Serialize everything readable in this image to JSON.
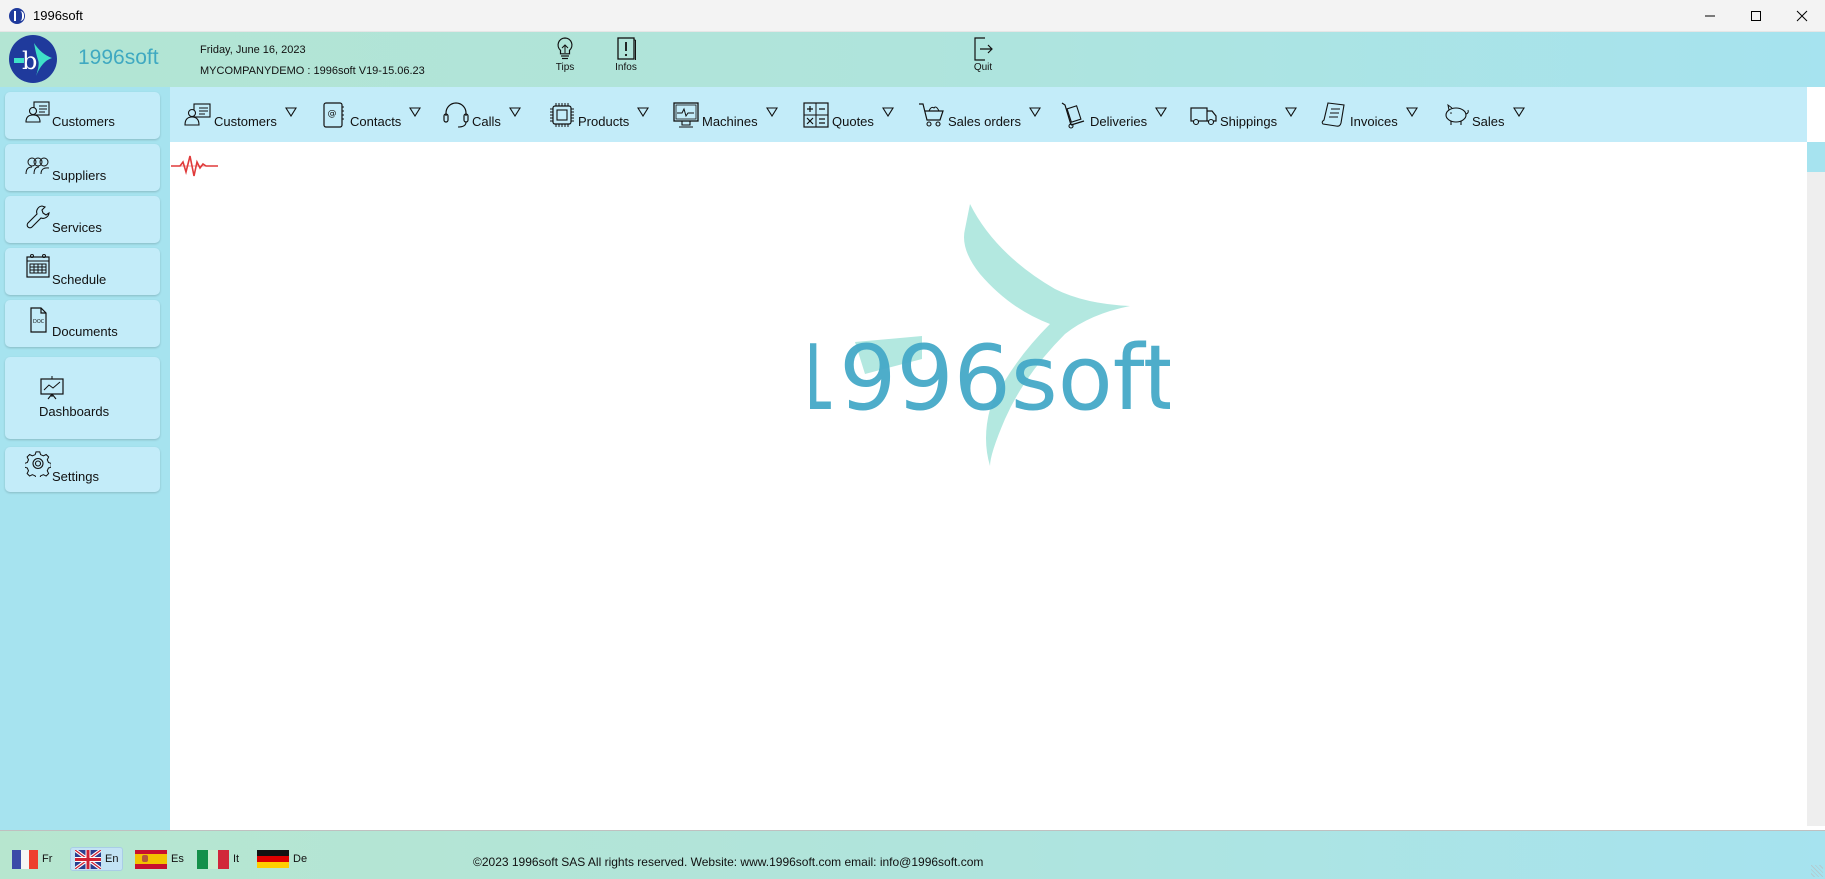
{
  "window": {
    "title": "1996soft",
    "controls": [
      "minimize",
      "maximize",
      "close"
    ]
  },
  "header": {
    "brand": "1996soft",
    "date": "Friday, June 16, 2023",
    "company": "MYCOMPANYDEMO : 1996soft V19-15.06.23",
    "buttons": [
      {
        "label": "Tips",
        "icon": "lightbulb-icon"
      },
      {
        "label": "Infos",
        "icon": "info-book-icon"
      },
      {
        "label": "Quit",
        "icon": "exit-icon"
      }
    ]
  },
  "sidebar": {
    "items": [
      {
        "label": "Customers",
        "icon": "customers-icon"
      },
      {
        "label": "Suppliers",
        "icon": "suppliers-icon"
      },
      {
        "label": "Services",
        "icon": "wrench-icon"
      },
      {
        "label": "Schedule",
        "icon": "calendar-icon"
      },
      {
        "label": "Documents",
        "icon": "document-icon"
      },
      {
        "label": "Dashboards",
        "icon": "dashboard-icon"
      },
      {
        "label": "Settings",
        "icon": "gear-icon"
      }
    ]
  },
  "navbar": {
    "items": [
      {
        "label": "Customers",
        "icon": "customers-icon"
      },
      {
        "label": "Contacts",
        "icon": "contacts-book-icon"
      },
      {
        "label": "Calls",
        "icon": "headset-icon"
      },
      {
        "label": "Products",
        "icon": "chip-icon"
      },
      {
        "label": "Machines",
        "icon": "monitor-icon"
      },
      {
        "label": "Quotes",
        "icon": "calculator-icon"
      },
      {
        "label": "Sales orders",
        "icon": "cart-icon"
      },
      {
        "label": "Deliveries",
        "icon": "hand-truck-icon"
      },
      {
        "label": "Shippings",
        "icon": "truck-icon"
      },
      {
        "label": "Invoices",
        "icon": "invoice-icon"
      },
      {
        "label": "Sales",
        "icon": "piggy-bank-icon"
      }
    ]
  },
  "content": {
    "logo_text": "1996soft",
    "activity_icon": "heartbeat-icon"
  },
  "footer": {
    "languages": [
      {
        "code": "Fr",
        "flag": "france-flag-icon",
        "active": false
      },
      {
        "code": "En",
        "flag": "uk-flag-icon",
        "active": true
      },
      {
        "code": "Es",
        "flag": "spain-flag-icon",
        "active": false
      },
      {
        "code": "It",
        "flag": "italy-flag-icon",
        "active": false
      },
      {
        "code": "De",
        "flag": "germany-flag-icon",
        "active": false
      }
    ],
    "copyright": "©2023 1996soft SAS All rights reserved. Website: www.1996soft.com email: info@1996soft.com"
  },
  "colors": {
    "brand_blue": "#3fa9c1",
    "logo_navy": "#1f3a9c",
    "logo_teal": "#b3e8e0",
    "sidebar_bg": "#a6e3ef",
    "button_bg": "#c3ecf9",
    "pulse_red": "#e03a3a"
  }
}
